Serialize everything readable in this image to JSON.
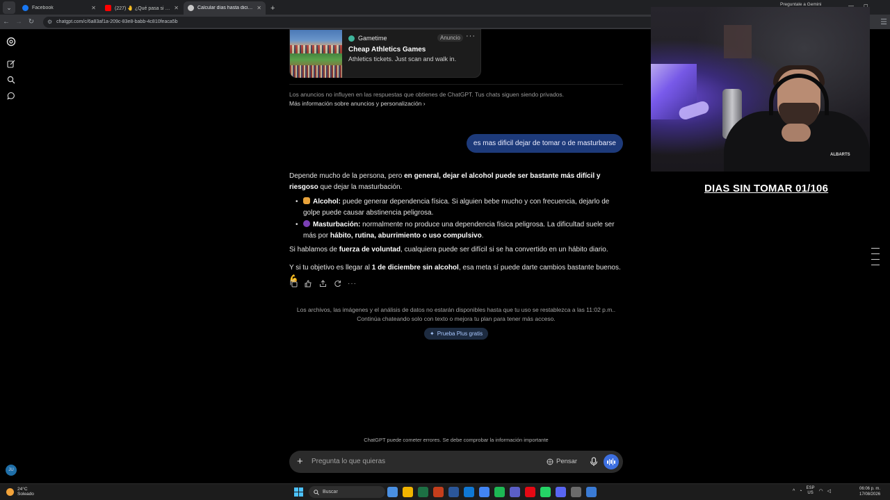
{
  "browser": {
    "tabs": [
      {
        "title": "Facebook",
        "icon_color": "#1877f2",
        "active": false
      },
      {
        "title": "(227) 🤚 ¿Qué pasa si DEJAS el",
        "icon_color": "#ff0000",
        "active": false
      },
      {
        "title": "Calcular días hasta diciembre",
        "icon_color": "#c8c8c8",
        "active": true
      }
    ],
    "url": "chatgpt.com/c/6a83af1a-209c-83e8-babb-4c810feaca5b"
  },
  "sidebar": {
    "avatar_initials": "JU"
  },
  "ad": {
    "brand": "Gametime",
    "badge": "Anuncio",
    "title": "Cheap Athletics Games",
    "subtitle": "Athletics tickets. Just scan and walk in.",
    "note": "Los anuncios no influyen en las respuestas que obtienes de ChatGPT. Tus chats siguen siendo privados.",
    "link": "Más información sobre anuncios y personalización"
  },
  "conversation": {
    "user_message": "es mas dificil dejar de tomar o de masturbarse",
    "answer": {
      "intro_plain": "Depende mucho de la persona, pero ",
      "intro_bold": "en general, dejar el alcohol puede ser bastante más difícil y riesgoso",
      "intro_end": " que dejar la masturbación.",
      "bullets": [
        {
          "emoji_color": "#e8a33b",
          "label": "Alcohol:",
          "text": " puede generar dependencia física. Si alguien bebe mucho y con frecuencia, dejarlo de golpe puede causar abstinencia peligrosa."
        },
        {
          "emoji_color": "#7a3fb5",
          "label": "Masturbación:",
          "text": " normalmente no produce una dependencia física peligrosa. La dificultad suele ser más por ",
          "bold_end": "hábito, rutina, aburrimiento o uso compulsivo",
          "end": "."
        }
      ],
      "p2_plain": "Si hablamos de ",
      "p2_bold": "fuerza de voluntad",
      "p2_end": ", cualquiera puede ser difícil si se ha convertido en un hábito diario.",
      "p3_plain": "Y si tu objetivo es llegar al ",
      "p3_bold": "1 de diciembre sin alcohol",
      "p3_end": ", esa meta sí puede darte cambios bastante buenos. 💪"
    },
    "limit_note_line1": "Los archivos, las imágenes y el análisis de datos no estarán disponibles hasta que tu uso se restablezca a las 11:02 p.m..",
    "limit_note_line2": "Continúa chateando solo con texto o mejora tu plan para tener más acceso.",
    "plus_button": "Prueba Plus gratis"
  },
  "composer": {
    "placeholder": "Pregunta lo que quieras",
    "think_label": "Pensar",
    "disclaimer": "ChatGPT puede cometer errores. Se debe comprobar la información importante"
  },
  "overlay": {
    "top_label": "Preguntale a Gemini",
    "counter_text": "DIAS SIN TOMAR 01/106",
    "cam_logo": "ALBARTS"
  },
  "taskbar": {
    "weather_temp": "24°C",
    "weather_desc": "Soleado",
    "search_label": "Buscar",
    "apps": [
      "#4a90e2",
      "#f1b400",
      "#1d7044",
      "#c43e1c",
      "#2b579a",
      "#0f78d4",
      "#4285f4",
      "#1db954",
      "#5b5fc7",
      "#e50914",
      "#25d366",
      "#5865f2",
      "#6b6b6b",
      "#3a7bd5"
    ],
    "lang_top": "ESP",
    "lang_bottom": "US",
    "time": "06:06 p. m.",
    "date": "17/08/2026"
  },
  "colors": {
    "user_bubble": "#1d3a7a",
    "accent": "#3d6fe0"
  }
}
